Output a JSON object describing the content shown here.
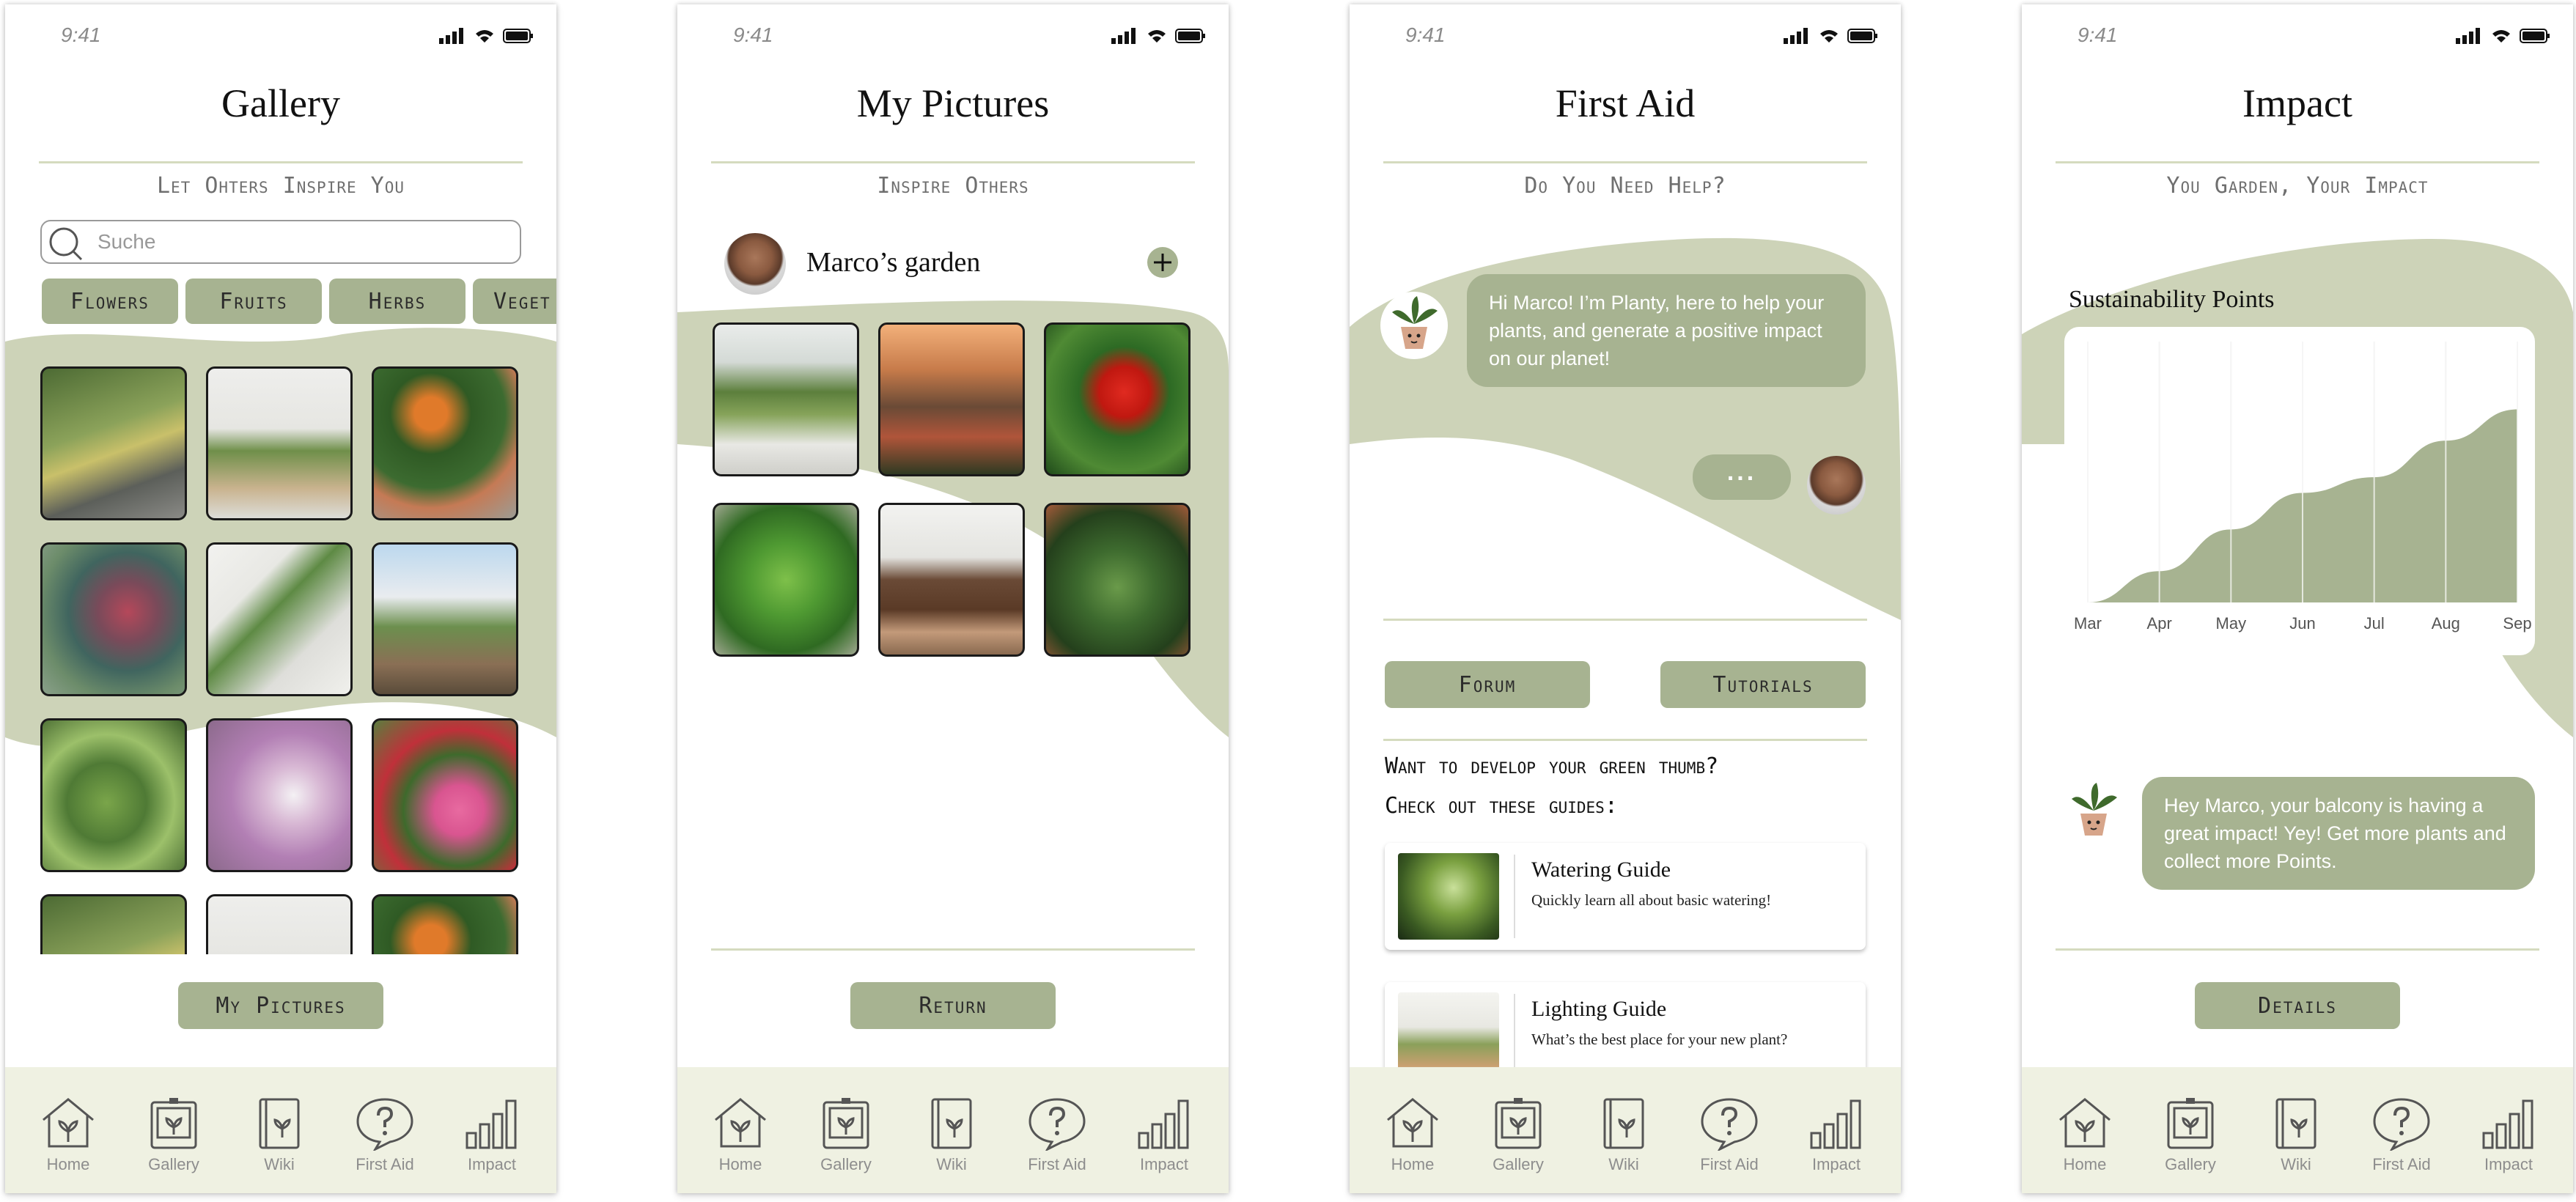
{
  "status": {
    "time": "9:41"
  },
  "nav": [
    "Home",
    "Gallery",
    "Wiki",
    "First Aid",
    "Impact"
  ],
  "screen1": {
    "title": "Gallery",
    "subtitle": "Let Ohters Inspire You",
    "search_placeholder": "Suche",
    "chips": [
      "Flowers",
      "Fruits",
      "Herbs",
      "Veget"
    ],
    "button": "My Pictures"
  },
  "screen2": {
    "title": "My Pictures",
    "subtitle": "Inspire Others",
    "garden_name": "Marco’s garden",
    "button": "Return"
  },
  "screen3": {
    "title": "First Aid",
    "subtitle": "Do You Need Help?",
    "bot_message": "Hi Marco! I’m Planty, here to help your plants, and generate a positive impact on our planet!",
    "typing": "...",
    "buttons": [
      "Forum",
      "Tutorials"
    ],
    "guides_heading_1": "Want to develop your green thumb?",
    "guides_heading_2": "Check out these guides:",
    "guides": [
      {
        "title": "Watering Guide",
        "desc": "Quickly learn all about basic watering!"
      },
      {
        "title": "Lighting Guide",
        "desc": "What’s the best place for your new plant?"
      }
    ]
  },
  "screen4": {
    "title": "Impact",
    "subtitle": "You Garden, Your Impact",
    "message": "Hey Marco, your balcony is having a great impact! Yey! Get more plants and collect more Points.",
    "button": "Details"
  },
  "chart_data": {
    "type": "area",
    "title": "Sustainability Points",
    "categories": [
      "Mar",
      "Apr",
      "May",
      "Jun",
      "Jul",
      "Aug",
      "Sep"
    ],
    "values": [
      0,
      12,
      28,
      42,
      48,
      62,
      74
    ],
    "ylim": [
      0,
      100
    ],
    "grid": true,
    "color": "#a7b391"
  },
  "colors": {
    "accent": "#a7b391",
    "nav_bg": "#eff1e2",
    "blob": "#cdd3b8",
    "divider": "#d5dbbf"
  }
}
